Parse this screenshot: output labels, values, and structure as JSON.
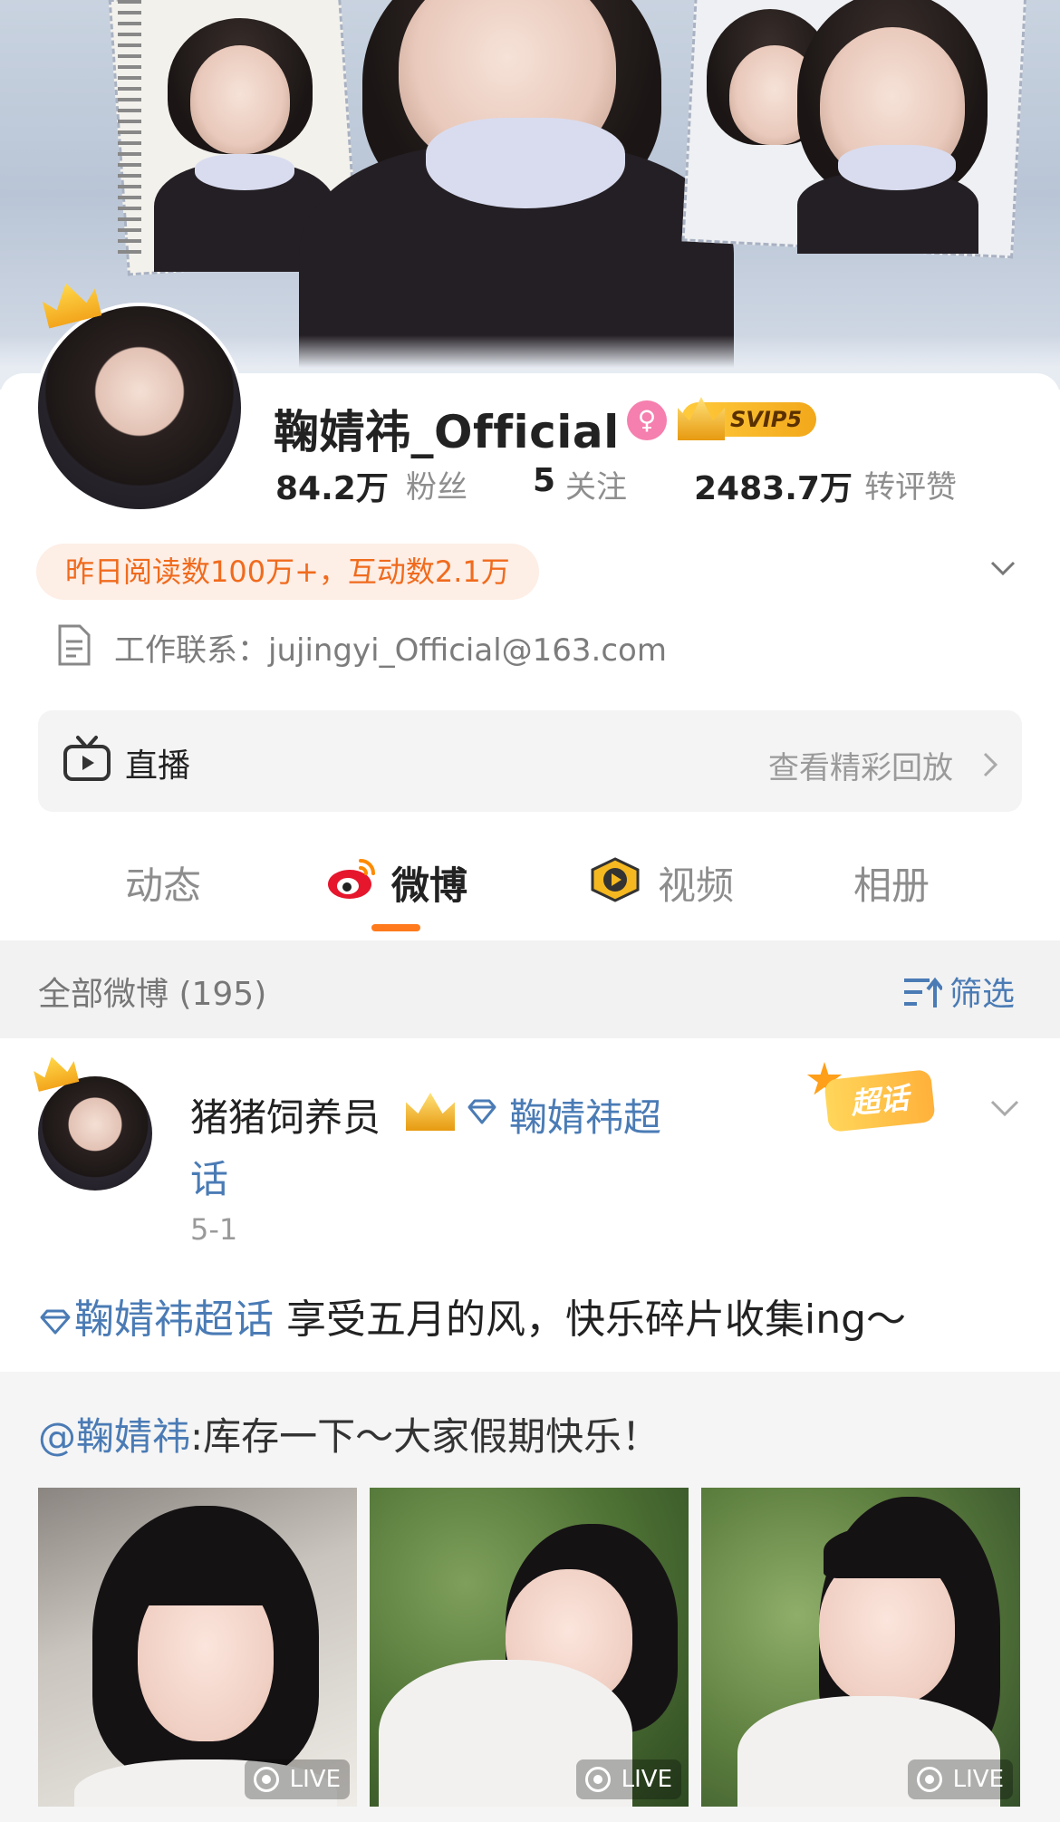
{
  "profile": {
    "username": "鞠婧祎_Official",
    "female_badge": "♀",
    "svip_label": "SVIP5",
    "stats": [
      {
        "num": "84.2万",
        "label": "粉丝"
      },
      {
        "num": "5",
        "label": "关注"
      },
      {
        "num": "2483.7万",
        "label": "转评赞"
      }
    ],
    "reads_pill": "昨日阅读数100万+，互动数2.1万",
    "contact": "工作联系：jujingyi_Official@163.com"
  },
  "live": {
    "label": "直播",
    "replay": "查看精彩回放"
  },
  "tabs": [
    {
      "label": "动态"
    },
    {
      "label": "微博"
    },
    {
      "label": "视频"
    },
    {
      "label": "相册"
    }
  ],
  "filter": {
    "count": "全部微博 (195)",
    "label": "筛选"
  },
  "post": {
    "author": "猪猪饲养员",
    "topic_line1": "鞠婧祎超",
    "topic_line2": "话",
    "date": "5-1",
    "badge": "超话",
    "body_topic": "鞠婧祎超话",
    "body_text": " 享受五月的风，快乐碎片收集ing～",
    "repost_mention": "@鞠婧祎",
    "repost_text": ":库存一下～大家假期快乐！",
    "photos": [
      {
        "live": "LIVE"
      },
      {
        "live": "LIVE"
      },
      {
        "live": "LIVE"
      }
    ]
  },
  "colors": {
    "accent_orange": "#ff7a1c",
    "link_blue": "#4a7bb5",
    "svip_gold": "#f2a81a",
    "female_pink": "#f57fae"
  }
}
